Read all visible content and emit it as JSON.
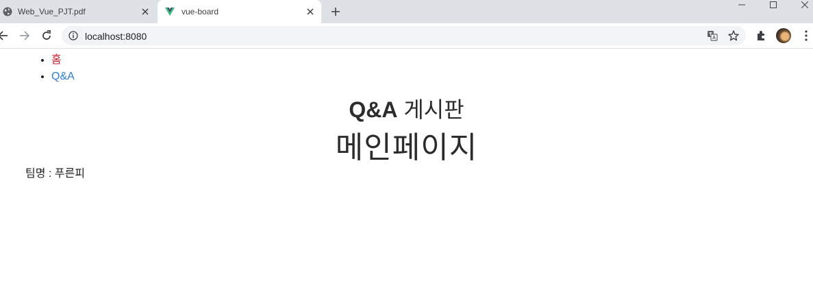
{
  "browser": {
    "tabs": [
      {
        "title": "Web_Vue_PJT.pdf",
        "favicon": "globe-icon",
        "active": false
      },
      {
        "title": "vue-board",
        "favicon": "vue-logo-icon",
        "active": true
      }
    ],
    "address": "localhost:8080",
    "colors": {
      "tabstrip": "#dee1e6",
      "omnibox": "#f1f3f4"
    }
  },
  "nav": {
    "items": [
      {
        "label": "홈",
        "color": "#c41e2a"
      },
      {
        "label": "Q&A",
        "color": "#2c7cd1"
      }
    ]
  },
  "main": {
    "board_title_bold": "Q&A",
    "board_title_rest": " 게시판",
    "page_title": "메인페이지",
    "team_text": "팀명 : 푸른피"
  }
}
